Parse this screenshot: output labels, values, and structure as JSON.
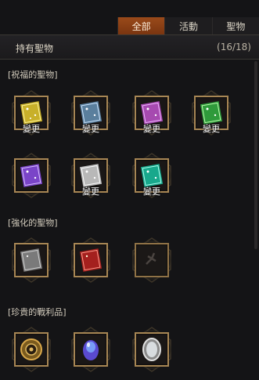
{
  "tabs": [
    "全部",
    "活動",
    "聖物"
  ],
  "header": {
    "title": "持有聖物",
    "count": "(16/18)"
  },
  "sections": [
    {
      "label": "[祝福的聖物]"
    },
    {
      "label": "[強化的聖物]"
    },
    {
      "label": "[珍貴的戰利品]"
    }
  ],
  "change_label": "變更",
  "items": [
    {
      "icon": "gold-relic-book-icon",
      "color": "#c8b02a",
      "label": "變更"
    },
    {
      "icon": "blue-relic-book-icon",
      "color": "#5a7f9d",
      "label": "變更"
    },
    {
      "icon": "purple-relic-book-icon",
      "color": "#a64ab0",
      "label": "變更"
    },
    {
      "icon": "green-relic-book-icon",
      "color": "#2f9a3b",
      "label": "變更"
    },
    {
      "icon": "violet-relic-book-icon",
      "color": "#7a44c8",
      "label": ""
    },
    {
      "icon": "silver-relic-book-icon",
      "color": "#b8b8b8",
      "label": "變更"
    },
    {
      "icon": "teal-relic-book-icon",
      "color": "#18a88c",
      "label": "變更"
    }
  ],
  "enhanced_items": [
    {
      "icon": "gray-relic-book-icon",
      "color": "#7a7a7a"
    },
    {
      "icon": "red-relic-book-icon",
      "color": "#a4201e"
    },
    {
      "icon": "broken-cross-relic-icon",
      "color": "#3a3533"
    }
  ],
  "loot_items": [
    {
      "icon": "golden-medallion-icon",
      "color": "#b88a2e"
    },
    {
      "icon": "blue-crystal-egg-icon",
      "color": "#5a4ad0"
    },
    {
      "icon": "silver-mirror-icon",
      "color": "#c9c9c9"
    }
  ]
}
